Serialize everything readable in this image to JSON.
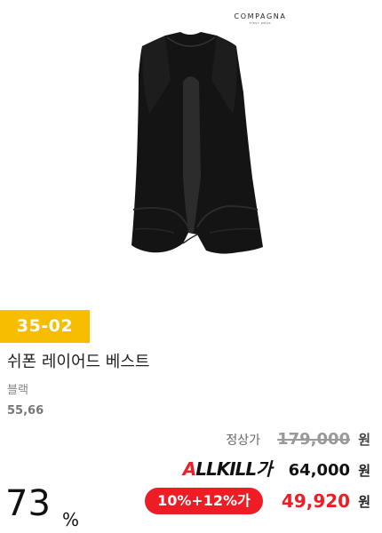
{
  "brand": {
    "name": "COMPAGNA",
    "sub": "FIRST WEAR"
  },
  "product": {
    "code": "35-02",
    "name": "쉬폰 레이어드 베스트",
    "color": "블랙",
    "sizes": "55,66"
  },
  "pricing": {
    "regular_label": "정상가",
    "regular_price": "179,000",
    "allkill_label_a": "A",
    "allkill_label_rest": "LLKILL가",
    "allkill_price": "64,000",
    "discount_pill": "10%+12%가",
    "sale_price": "49,920",
    "currency": "원",
    "discount_rate": "73",
    "discount_unit": "%"
  },
  "colors": {
    "badge": "#f7bd00",
    "sale": "#ee1c25"
  }
}
